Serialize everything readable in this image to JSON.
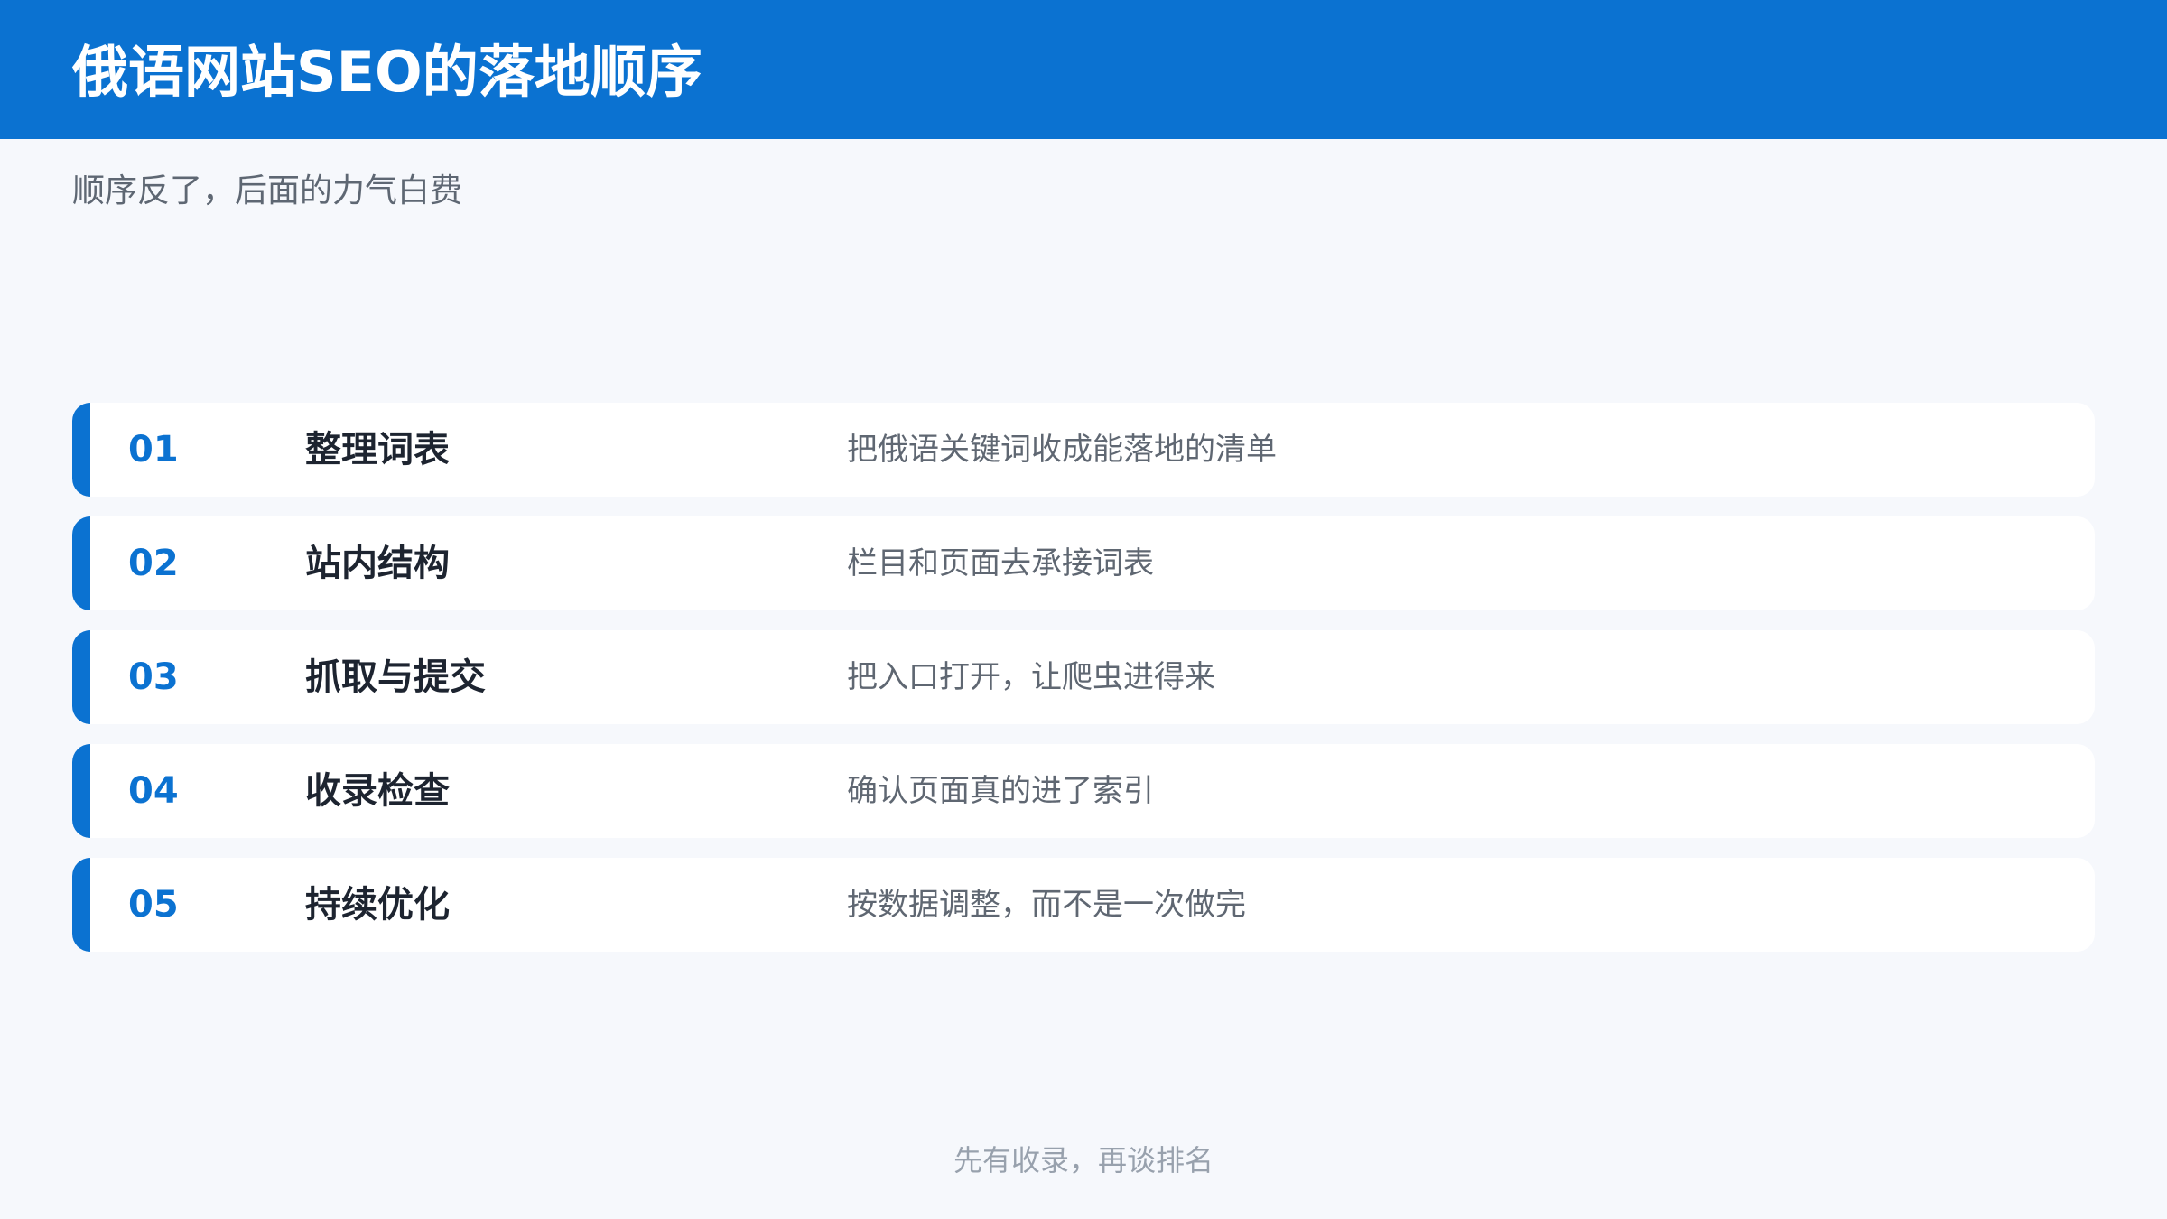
{
  "header": {
    "title": "俄语网站SEO的落地顺序"
  },
  "subtitle": "顺序反了，后面的力气白费",
  "steps": [
    {
      "number": "01",
      "title": "整理词表",
      "description": "把俄语关键词收成能落地的清单"
    },
    {
      "number": "02",
      "title": "站内结构",
      "description": "栏目和页面去承接词表"
    },
    {
      "number": "03",
      "title": "抓取与提交",
      "description": "把入口打开，让爬虫进得来"
    },
    {
      "number": "04",
      "title": "收录检查",
      "description": "确认页面真的进了索引"
    },
    {
      "number": "05",
      "title": "持续优化",
      "description": "按数据调整，而不是一次做完"
    }
  ],
  "footer": "先有收录，再谈排名",
  "colors": {
    "accent": "#0b72d1",
    "background": "#f6f8fc",
    "card": "#ffffff",
    "title_text": "#1d2430",
    "muted_text": "#5f6772",
    "footer_text": "#98a1ad"
  }
}
